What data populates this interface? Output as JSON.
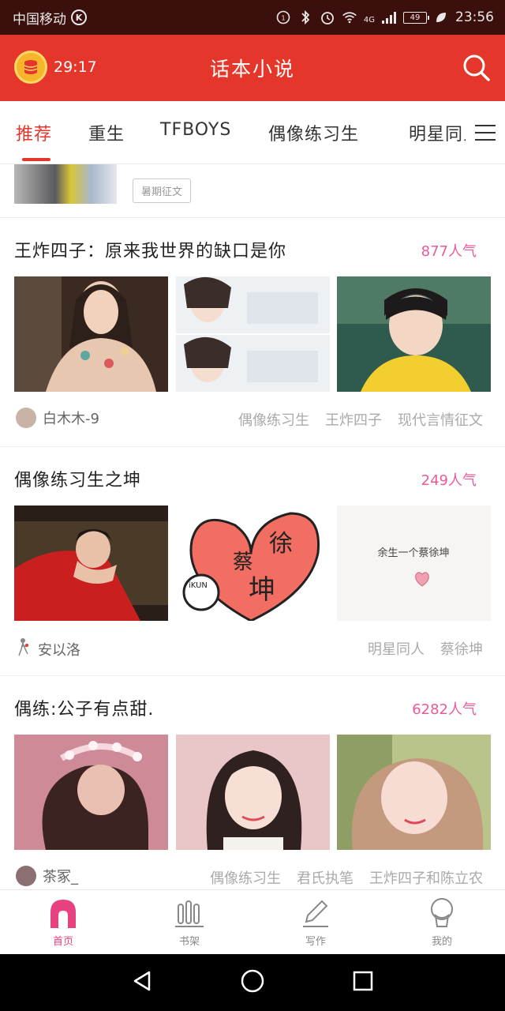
{
  "status_bar": {
    "carrier": "中国移动",
    "carrier_badge": "K",
    "network": "4G",
    "battery": "49",
    "time": "23:56"
  },
  "header": {
    "timer": "29:17",
    "title": "话本小说"
  },
  "tabs": [
    {
      "label": "推荐",
      "active": true
    },
    {
      "label": "重生",
      "active": false
    },
    {
      "label": "TFBOYS",
      "active": false
    },
    {
      "label": "偶像练习生",
      "active": false
    },
    {
      "label": "明星同人",
      "active": false
    }
  ],
  "previous_card": {
    "tag": "暑期征文"
  },
  "cards": [
    {
      "title": "王炸四子：原来我世界的缺口是你",
      "popularity": "877人气",
      "author": "白木木-9",
      "tags": [
        "偶像练习生",
        "王炸四子",
        "现代言情征文"
      ]
    },
    {
      "title": "偶像练习生之坤",
      "popularity": "249人气",
      "author": "安以洛",
      "tags": [
        "明星同人",
        "蔡徐坤"
      ],
      "image_text": {
        "heart_a": "徐",
        "heart_b": "蔡",
        "heart_c": "坤",
        "badge": "iKUN",
        "caption": "余生一个蔡徐坤"
      }
    },
    {
      "title": "偶练:公子有点甜.",
      "popularity": "6282人气",
      "author": "茶冢_",
      "tags": [
        "偶像练习生",
        "君氏执笔",
        "王炸四子和陈立农"
      ]
    }
  ],
  "bottom_nav": [
    {
      "label": "首页",
      "icon": "home-icon",
      "active": true
    },
    {
      "label": "书架",
      "icon": "bookshelf-icon",
      "active": false
    },
    {
      "label": "写作",
      "icon": "pen-icon",
      "active": false
    },
    {
      "label": "我的",
      "icon": "profile-icon",
      "active": false
    }
  ],
  "colors": {
    "accent": "#e4362a",
    "popularity": "#e95a9a",
    "nav_active": "#e7417f"
  }
}
